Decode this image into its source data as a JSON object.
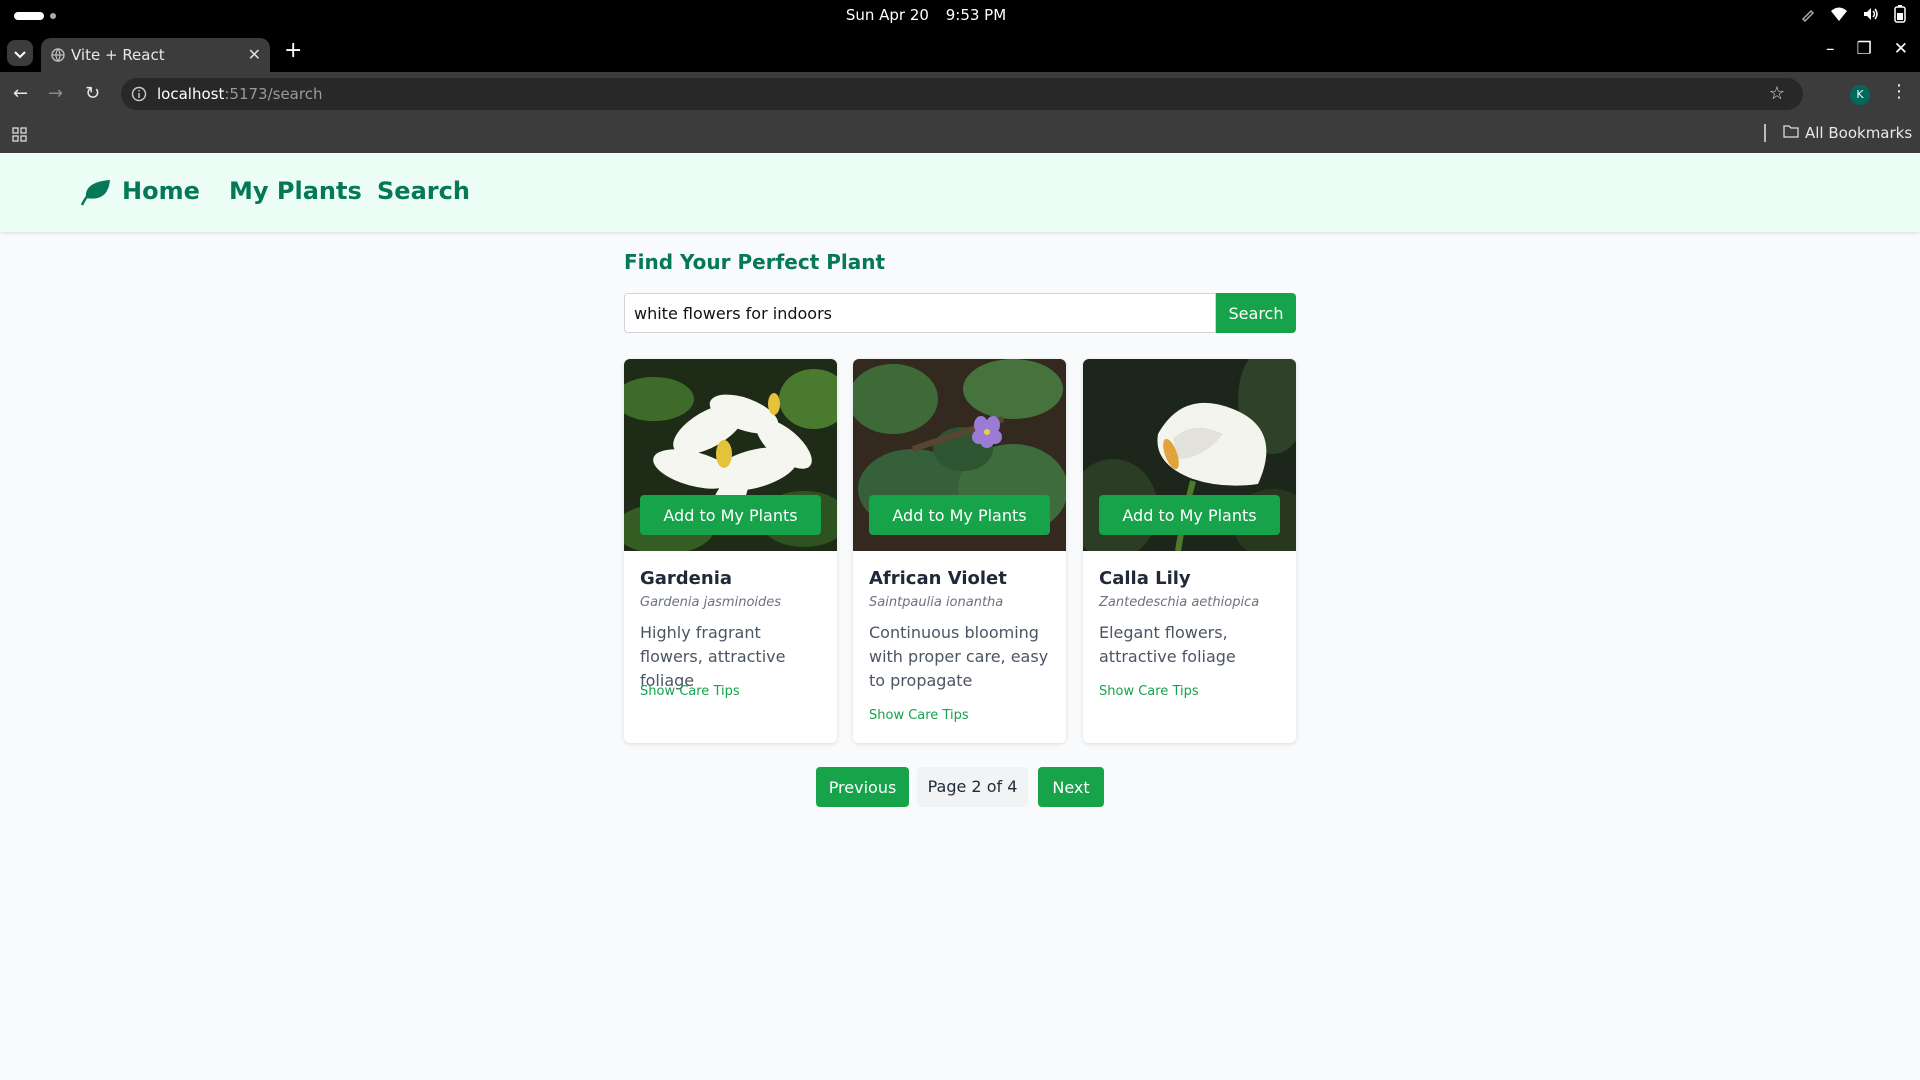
{
  "os": {
    "date": "Sun Apr 20",
    "time": "9:53 PM"
  },
  "browser": {
    "tab_title": "Vite + React",
    "url_host": "localhost",
    "url_path": ":5173/search",
    "profile_initial": "K",
    "bookmarks_label": "All Bookmarks"
  },
  "nav": {
    "home": "Home",
    "my_plants": "My Plants",
    "search": "Search"
  },
  "page": {
    "title": "Find Your Perfect Plant",
    "search_value": "white flowers for indoors",
    "search_button": "Search",
    "add_button": "Add to My Plants",
    "care_tips_label": "Show Care Tips"
  },
  "plants": [
    {
      "name": "Gardenia",
      "scientific": "Gardenia jasminoides",
      "description": "Highly fragrant flowers, attractive foliage"
    },
    {
      "name": "African Violet",
      "scientific": "Saintpaulia ionantha",
      "description": "Continuous blooming with proper care, easy to propagate"
    },
    {
      "name": "Calla Lily",
      "scientific": "Zantedeschia aethiopica",
      "description": "Elegant flowers, attractive foliage"
    }
  ],
  "pagination": {
    "previous": "Previous",
    "label": "Page 2 of 4",
    "next": "Next"
  },
  "colors": {
    "accent": "#16a34a",
    "nav_text": "#047857",
    "nav_bg": "#ecfdf5"
  }
}
